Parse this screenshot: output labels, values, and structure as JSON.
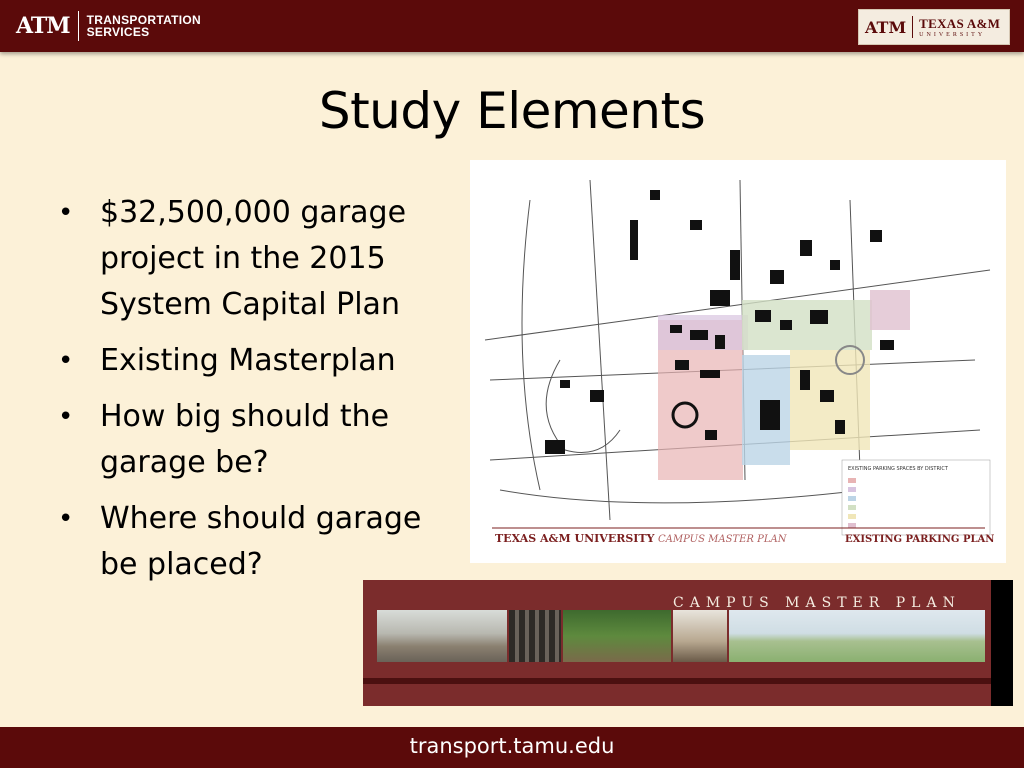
{
  "header": {
    "left_logo_mark": "ATM",
    "left_logo_text_line1": "TRANSPORTATION",
    "left_logo_text_line2": "SERVICES",
    "right_logo_mark": "ATM",
    "right_logo_name": "TEXAS A&M",
    "right_logo_sub": "UNIVERSITY"
  },
  "slide": {
    "title": "Study Elements",
    "bullets": [
      "$32,500,000 garage project in the 2015 System Capital Plan",
      "Existing Masterplan",
      "How big should the garage be?",
      "Where should garage be placed?"
    ]
  },
  "map": {
    "footer_title": "TEXAS A&M UNIVERSITY",
    "footer_subtitle": "CAMPUS MASTER PLAN",
    "footer_plan_name": "EXISTING PARKING PLAN",
    "legend_title": "EXISTING PARKING SPACES BY DISTRICT"
  },
  "banner": {
    "title": "CAMPUS MASTER PLAN"
  },
  "footer": {
    "url": "transport.tamu.edu"
  }
}
